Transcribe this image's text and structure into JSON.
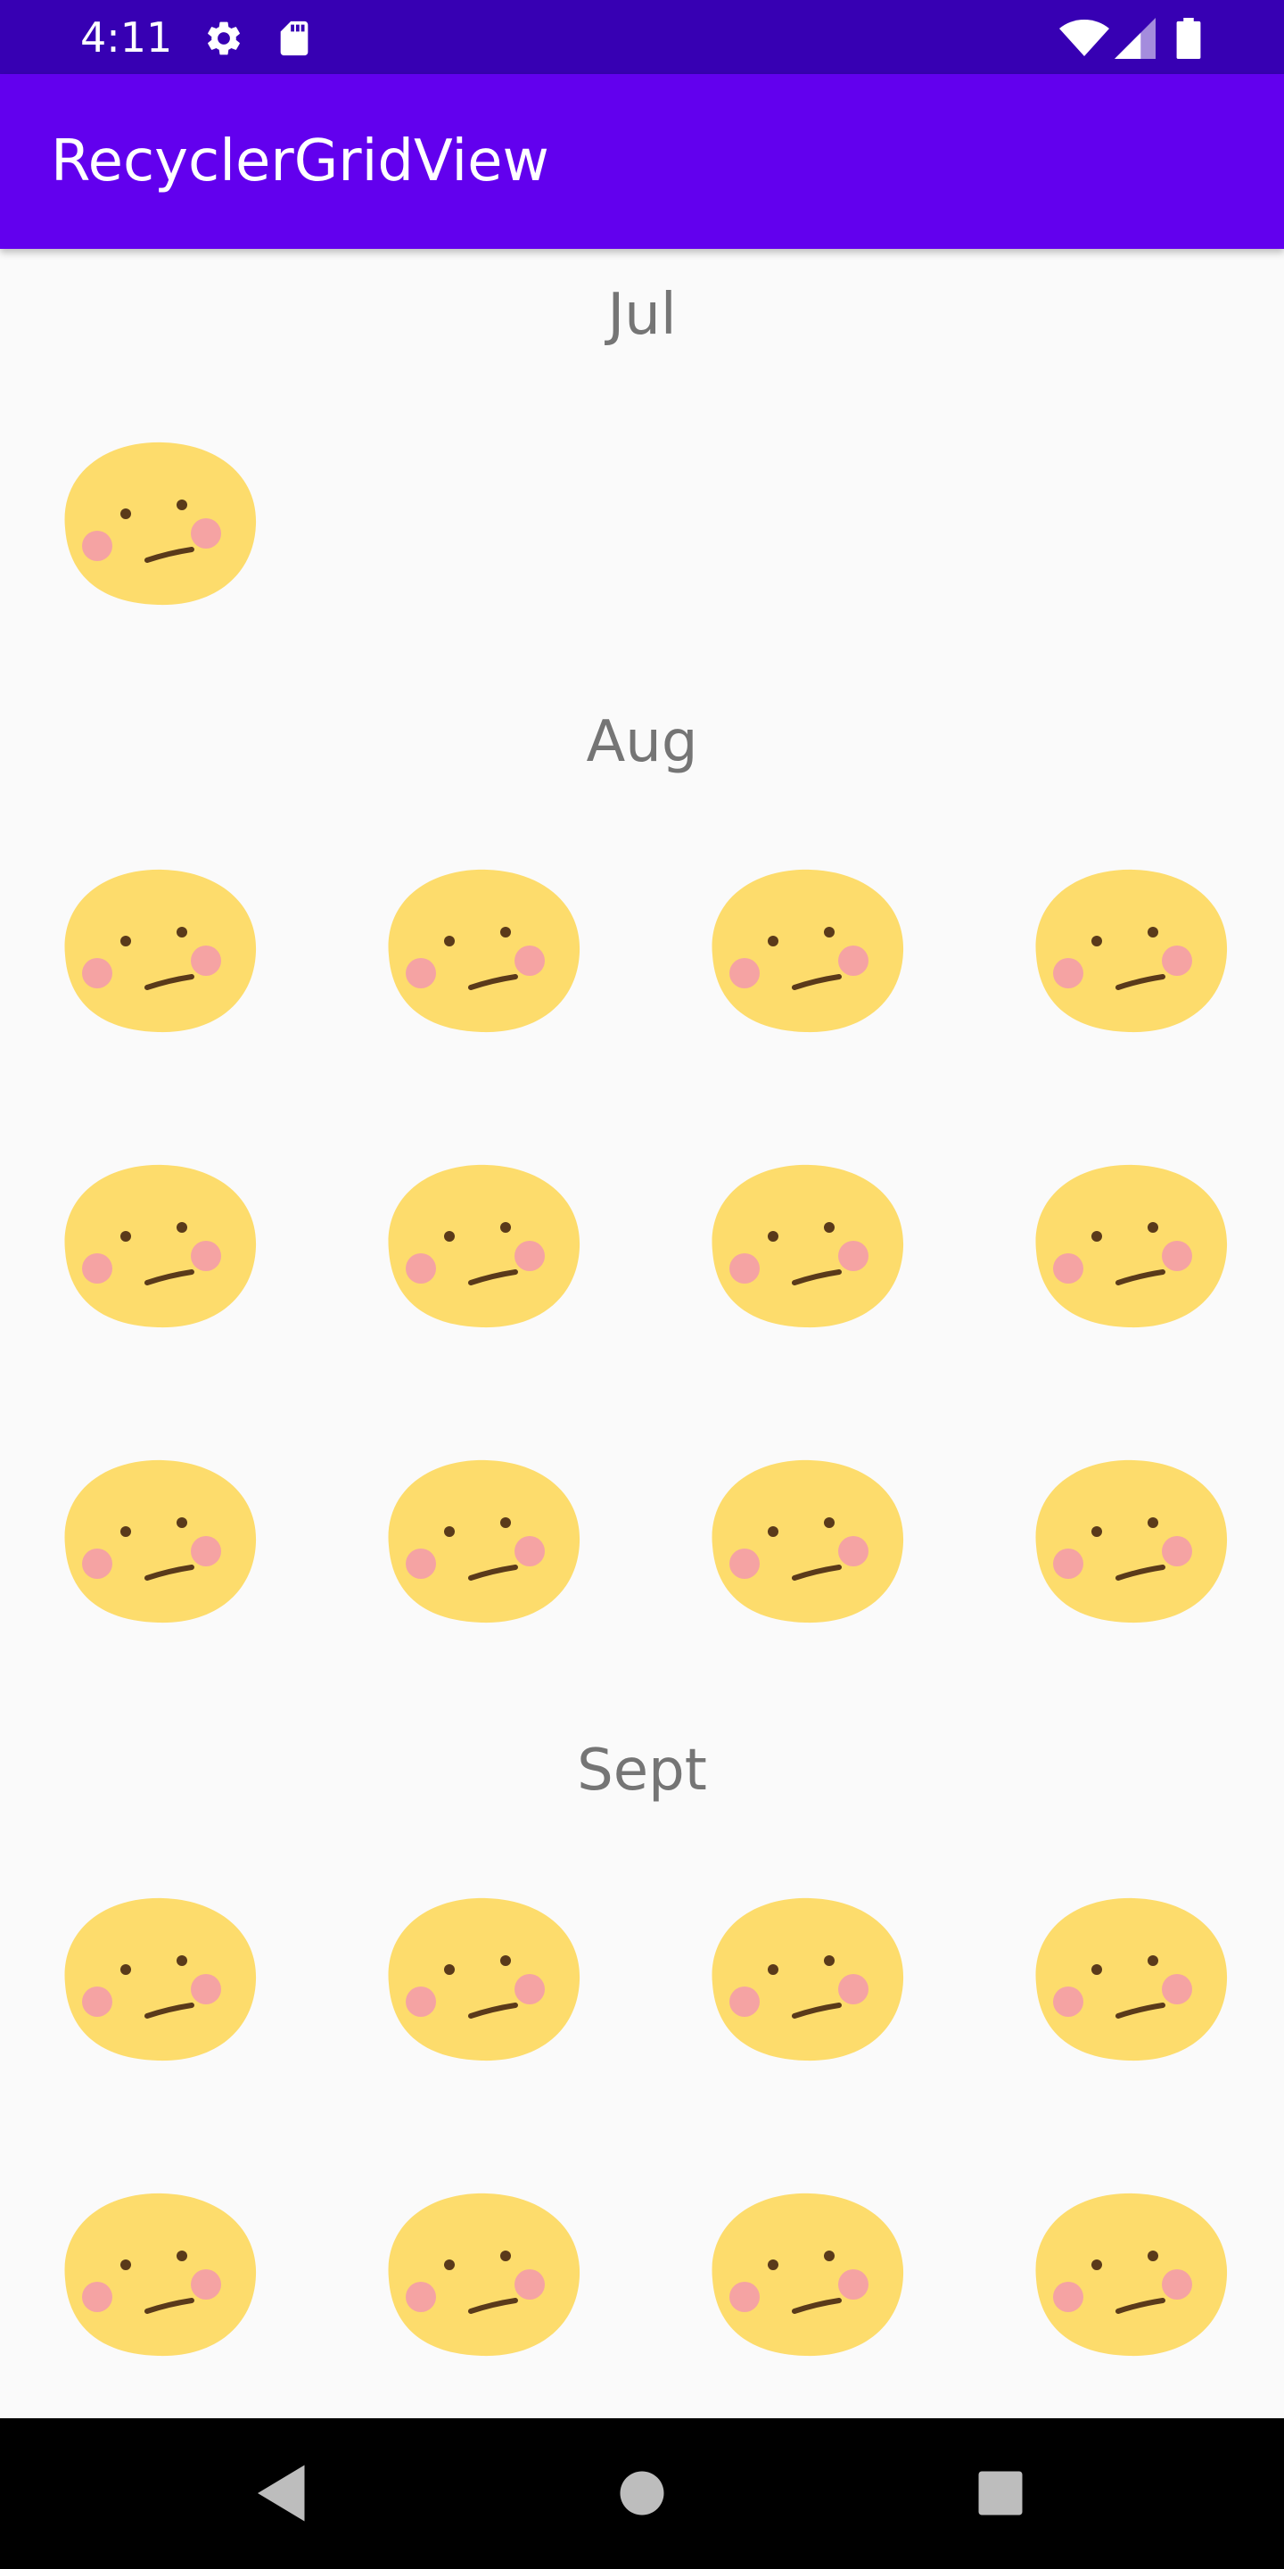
{
  "status_bar": {
    "time": "4:11",
    "icons_left": [
      "settings-icon",
      "sd-card-icon"
    ],
    "icons_right": [
      "wifi-icon",
      "cell-signal-icon",
      "battery-icon"
    ],
    "background": "#3700b3"
  },
  "app_bar": {
    "title": "RecyclerGridView",
    "background": "#6200ee"
  },
  "sections": [
    {
      "label": "Jul",
      "item_count": 1
    },
    {
      "label": "Aug",
      "item_count": 12
    },
    {
      "label": "Sept",
      "item_count": 8
    }
  ],
  "grid_item_icon": "confused-face-emoji-icon",
  "colors": {
    "face": "#fddc6c",
    "cheek": "#f5a3a3",
    "feature": "#5a3a1a",
    "header_text": "#757575",
    "background": "#fafafa"
  },
  "nav_bar": {
    "buttons": [
      "back-icon",
      "home-icon",
      "recents-icon"
    ]
  }
}
